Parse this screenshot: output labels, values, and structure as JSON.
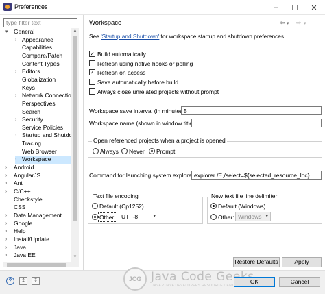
{
  "window": {
    "title": "Preferences",
    "minimize": "–",
    "maximize": "☐",
    "close": "✕"
  },
  "filter": {
    "placeholder": "type filter text"
  },
  "tree": [
    {
      "label": "General",
      "arrow": "▾"
    },
    {
      "label": "Appearance",
      "arrow": "›"
    },
    {
      "label": "Capabilities",
      "arrow": ""
    },
    {
      "label": "Compare/Patch",
      "arrow": ""
    },
    {
      "label": "Content Types",
      "arrow": ""
    },
    {
      "label": "Editors",
      "arrow": "›"
    },
    {
      "label": "Globalization",
      "arrow": ""
    },
    {
      "label": "Keys",
      "arrow": ""
    },
    {
      "label": "Network Connection",
      "arrow": "›"
    },
    {
      "label": "Perspectives",
      "arrow": ""
    },
    {
      "label": "Search",
      "arrow": ""
    },
    {
      "label": "Security",
      "arrow": "›"
    },
    {
      "label": "Service Policies",
      "arrow": ""
    },
    {
      "label": "Startup and Shutdown",
      "arrow": "›"
    },
    {
      "label": "Tracing",
      "arrow": ""
    },
    {
      "label": "Web Browser",
      "arrow": ""
    },
    {
      "label": "Workspace",
      "arrow": "›"
    },
    {
      "label": "Android",
      "arrow": "›"
    },
    {
      "label": "AngularJS",
      "arrow": "›"
    },
    {
      "label": "Ant",
      "arrow": "›"
    },
    {
      "label": "C/C++",
      "arrow": "›"
    },
    {
      "label": "Checkstyle",
      "arrow": ""
    },
    {
      "label": "CSS",
      "arrow": ""
    },
    {
      "label": "Data Management",
      "arrow": "›"
    },
    {
      "label": "Google",
      "arrow": "›"
    },
    {
      "label": "Help",
      "arrow": "›"
    },
    {
      "label": "Install/Update",
      "arrow": "›"
    },
    {
      "label": "Java",
      "arrow": "›"
    },
    {
      "label": "Java EE",
      "arrow": "›"
    }
  ],
  "page": {
    "title": "Workspace",
    "nav": {
      "back": "⇦",
      "back_menu": "▾",
      "forward": "⇨",
      "forward_menu": "▾",
      "menu": "⋮"
    },
    "see_prefix": "See ",
    "see_link": "'Startup and Shutdown'",
    "see_suffix": " for workspace startup and shutdown preferences."
  },
  "checkboxes": [
    {
      "label": "Build automatically",
      "checked": "✓"
    },
    {
      "label": "Refresh using native hooks or polling",
      "checked": ""
    },
    {
      "label": "Refresh on access",
      "checked": "✓"
    },
    {
      "label": "Save automatically before build",
      "checked": ""
    },
    {
      "label": "Always close unrelated projects without prompt",
      "checked": ""
    }
  ],
  "save_interval": {
    "label": "Workspace save interval (in minutes):",
    "value": "5"
  },
  "workspace_name": {
    "label": "Workspace name (shown in window title):",
    "value": ""
  },
  "open_projects": {
    "title": "Open referenced projects when a project is opened",
    "options": [
      "Always",
      "Never",
      "Prompt"
    ],
    "selected": "Prompt"
  },
  "explorer": {
    "label": "Command for launching system explorer:",
    "value": "explorer /E,/select=${selected_resource_loc}"
  },
  "encoding": {
    "title": "Text file encoding",
    "default_label": "Default (Cp1252)",
    "other_label": "Other:",
    "other_value": "UTF-8",
    "caret": "▾"
  },
  "line_delimiter": {
    "title": "New text file line delimiter",
    "default_label": "Default (Windows)",
    "other_label": "Other:",
    "other_value": "Windows",
    "caret": "▾"
  },
  "buttons": {
    "restore": "Restore Defaults",
    "apply": "Apply",
    "ok": "OK",
    "cancel": "Cancel"
  },
  "bottom": {
    "help": "?",
    "import": "↥",
    "export": "↧"
  },
  "watermark": {
    "logo": "JCG",
    "title": "Java Code Geeks",
    "subtitle": "JAVA 2 JAVA DEVELOPERS RESOURCE CENTER"
  },
  "colors": {
    "selection": "#cce8ff",
    "link": "#1a4fa8",
    "focus_border": "#0078d7"
  }
}
